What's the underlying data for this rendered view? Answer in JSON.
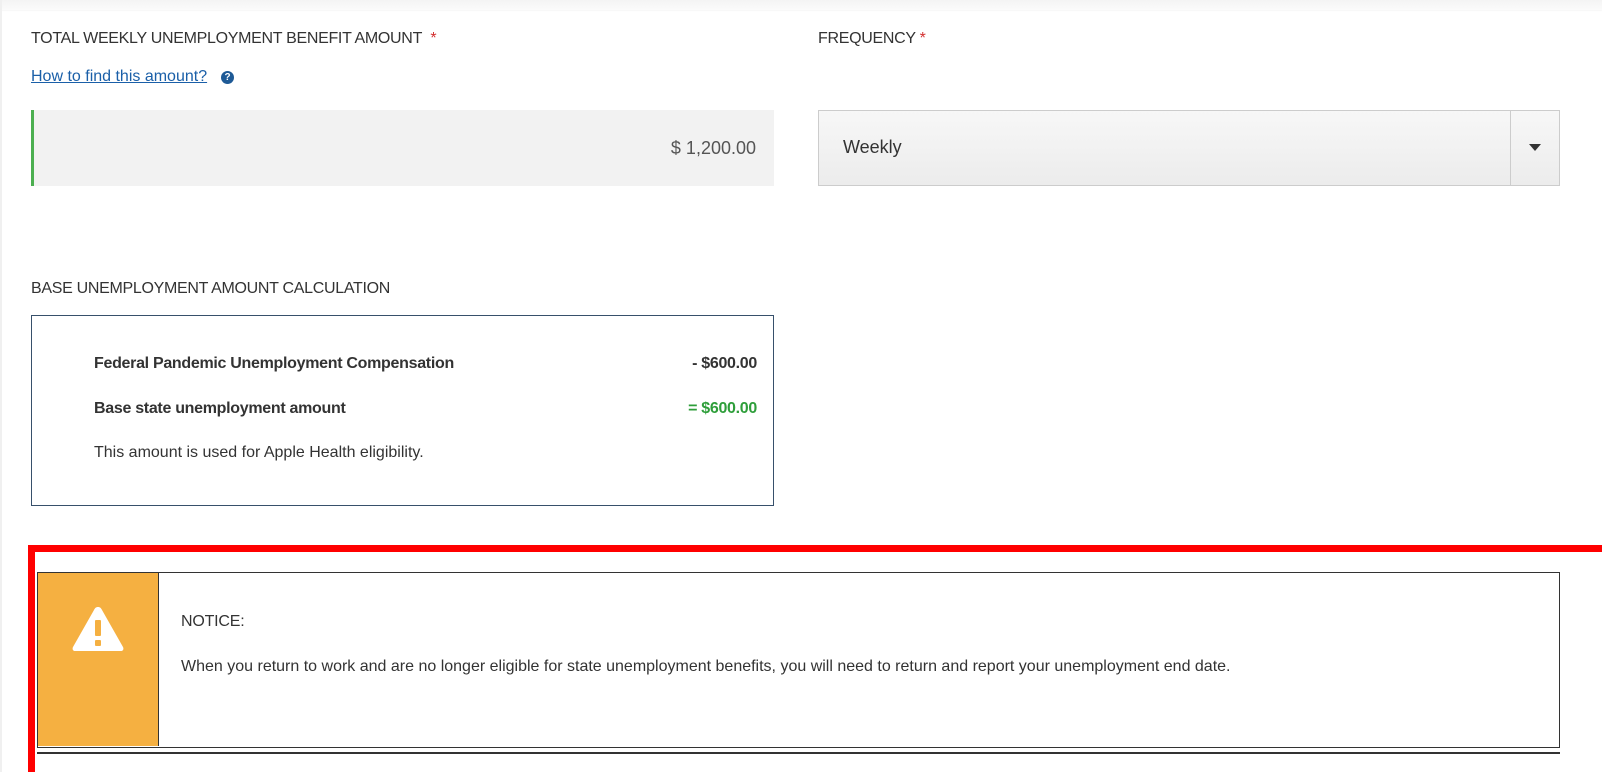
{
  "benefit": {
    "label": "TOTAL WEEKLY UNEMPLOYMENT BENEFIT AMOUNT",
    "required_mark": "*",
    "help_link": "How to find this amount?",
    "help_icon": "question-circle-icon",
    "value": "$ 1,200.00"
  },
  "frequency": {
    "label": "FREQUENCY",
    "required_mark": "*",
    "selected": "Weekly"
  },
  "calculation": {
    "heading": "BASE UNEMPLOYMENT AMOUNT CALCULATION",
    "rows": [
      {
        "label": "Federal Pandemic Unemployment Compensation",
        "value": "- $600.00"
      },
      {
        "label": "Base state unemployment amount",
        "value": "= $600.00"
      }
    ],
    "note": "This amount is used for Apple Health eligibility."
  },
  "notice": {
    "icon": "warning-triangle-icon",
    "title": "NOTICE:",
    "body": "When you return to work and are no longer eligible for state unemployment benefits, you will need to return and report your unemployment end date."
  },
  "colors": {
    "required": "#d32f2f",
    "link": "#1a5fa8",
    "valid_border": "#4caf50",
    "positive_value": "#2e9e3a",
    "notice_accent": "#f5b041",
    "highlight_frame": "#ff0000"
  }
}
